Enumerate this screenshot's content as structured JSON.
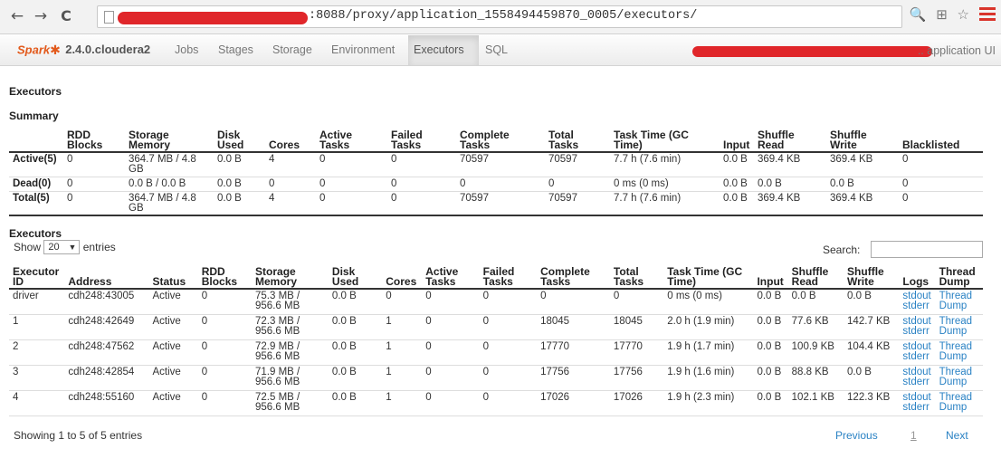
{
  "browser": {
    "url_visible": ":8088/proxy/application_1558494459870_0005/executors/",
    "icons": [
      "back-icon",
      "forward-icon",
      "reload-icon",
      "page-icon",
      "zoom-icon",
      "translate-icon",
      "star-icon",
      "menu-icon"
    ],
    "glyphs": {
      "back": "←",
      "forward": "→",
      "reload": "C",
      "right_icons": "🔍 ⊞ ☆"
    }
  },
  "navbar": {
    "brand_word": "Spark",
    "brand_star": "✱",
    "version": "2.4.0.cloudera2",
    "tabs": [
      "Jobs",
      "Stages",
      "Storage",
      "Environment",
      "Executors",
      "SQL"
    ],
    "active_tab": "Executors",
    "right_text": ".. application UI"
  },
  "page_title": "Executors",
  "summary": {
    "title": "Summary",
    "headers": [
      "",
      "RDD Blocks",
      "Storage Memory",
      "Disk Used",
      "Cores",
      "Active Tasks",
      "Failed Tasks",
      "Complete Tasks",
      "Total Tasks",
      "Task Time (GC Time)",
      "Input",
      "Shuffle Read",
      "Shuffle Write",
      "Blacklisted"
    ],
    "rows": [
      [
        "Active(5)",
        "0",
        "364.7 MB / 4.8 GB",
        "0.0 B",
        "4",
        "0",
        "0",
        "70597",
        "70597",
        "7.7 h (7.6 min)",
        "0.0 B",
        "369.4 KB",
        "369.4 KB",
        "0"
      ],
      [
        "Dead(0)",
        "0",
        "0.0 B / 0.0 B",
        "0.0 B",
        "0",
        "0",
        "0",
        "0",
        "0",
        "0 ms (0 ms)",
        "0.0 B",
        "0.0 B",
        "0.0 B",
        "0"
      ],
      [
        "Total(5)",
        "0",
        "364.7 MB / 4.8 GB",
        "0.0 B",
        "4",
        "0",
        "0",
        "70597",
        "70597",
        "7.7 h (7.6 min)",
        "0.0 B",
        "369.4 KB",
        "369.4 KB",
        "0"
      ]
    ]
  },
  "executors": {
    "title": "Executors",
    "show_label": "Show",
    "entries_label": "entries",
    "page_size": "20",
    "search_label": "Search:",
    "search_value": "",
    "headers": [
      "Executor ID",
      "Address",
      "Status",
      "RDD Blocks",
      "Storage Memory",
      "Disk Used",
      "Cores",
      "Active Tasks",
      "Failed Tasks",
      "Complete Tasks",
      "Total Tasks",
      "Task Time (GC Time)",
      "Input",
      "Shuffle Read",
      "Shuffle Write",
      "Logs",
      "Thread Dump"
    ],
    "rows": [
      {
        "id": "driver",
        "address": "cdh248:43005",
        "status": "Active",
        "rdd": "0",
        "storage": "75.3 MB / 956.6 MB",
        "disk": "0.0 B",
        "cores": "0",
        "active": "0",
        "failed": "0",
        "complete": "0",
        "total": "0",
        "time": "0 ms (0 ms)",
        "input": "0.0 B",
        "sread": "0.0 B",
        "swrite": "0.0 B",
        "log1": "stdout",
        "log2": "stderr",
        "td1": "Thread",
        "td2": "Dump"
      },
      {
        "id": "1",
        "address": "cdh248:42649",
        "status": "Active",
        "rdd": "0",
        "storage": "72.3 MB / 956.6 MB",
        "disk": "0.0 B",
        "cores": "1",
        "active": "0",
        "failed": "0",
        "complete": "18045",
        "total": "18045",
        "time": "2.0 h (1.9 min)",
        "input": "0.0 B",
        "sread": "77.6 KB",
        "swrite": "142.7 KB",
        "log1": "stdout",
        "log2": "stderr",
        "td1": "Thread",
        "td2": "Dump"
      },
      {
        "id": "2",
        "address": "cdh248:47562",
        "status": "Active",
        "rdd": "0",
        "storage": "72.9 MB / 956.6 MB",
        "disk": "0.0 B",
        "cores": "1",
        "active": "0",
        "failed": "0",
        "complete": "17770",
        "total": "17770",
        "time": "1.9 h (1.7 min)",
        "input": "0.0 B",
        "sread": "100.9 KB",
        "swrite": "104.4 KB",
        "log1": "stdout",
        "log2": "stderr",
        "td1": "Thread",
        "td2": "Dump"
      },
      {
        "id": "3",
        "address": "cdh248:42854",
        "status": "Active",
        "rdd": "0",
        "storage": "71.9 MB / 956.6 MB",
        "disk": "0.0 B",
        "cores": "1",
        "active": "0",
        "failed": "0",
        "complete": "17756",
        "total": "17756",
        "time": "1.9 h (1.6 min)",
        "input": "0.0 B",
        "sread": "88.8 KB",
        "swrite": "0.0 B",
        "log1": "stdout",
        "log2": "stderr",
        "td1": "Thread",
        "td2": "Dump"
      },
      {
        "id": "4",
        "address": "cdh248:55160",
        "status": "Active",
        "rdd": "0",
        "storage": "72.5 MB / 956.6 MB",
        "disk": "0.0 B",
        "cores": "1",
        "active": "0",
        "failed": "0",
        "complete": "17026",
        "total": "17026",
        "time": "1.9 h (2.3 min)",
        "input": "0.0 B",
        "sread": "102.1 KB",
        "swrite": "122.3 KB",
        "log1": "stdout",
        "log2": "stderr",
        "td1": "Thread",
        "td2": "Dump"
      }
    ],
    "info": "Showing 1 to 5 of 5 entries",
    "pagination": {
      "previous": "Previous",
      "current": "1",
      "next": "Next"
    }
  },
  "colors": {
    "spark_orange": "#e25a1c",
    "link_blue": "#2a82c4",
    "redaction_red": "#e0262a"
  }
}
